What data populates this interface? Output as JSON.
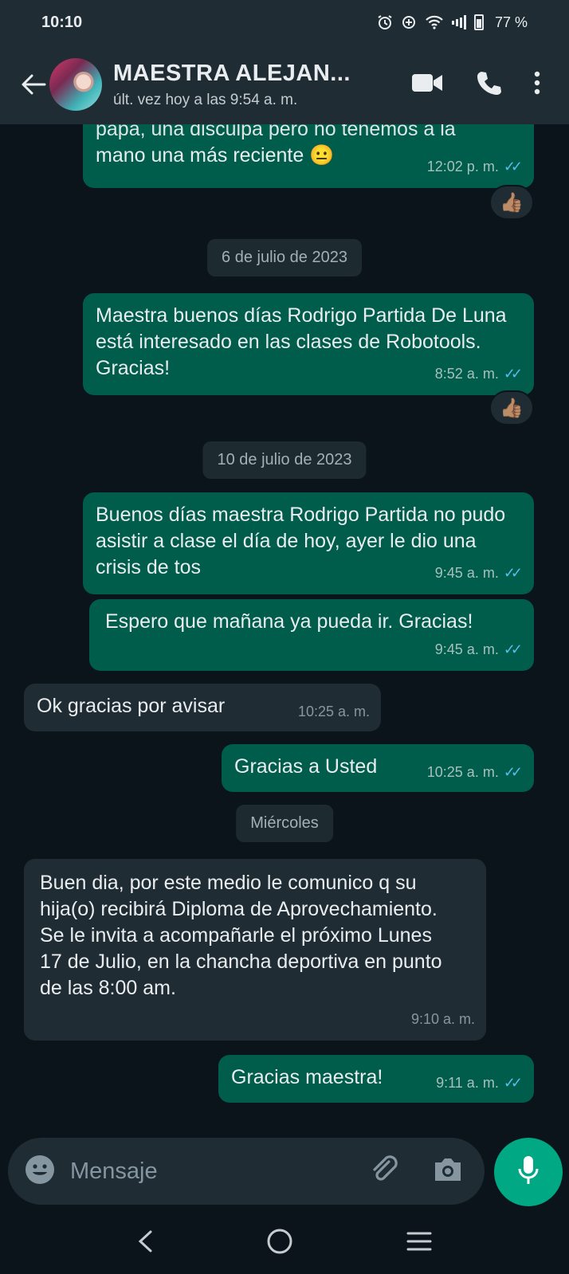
{
  "status_bar": {
    "time": "10:10",
    "battery": "77 %",
    "icons": [
      "alarm-icon",
      "data-saver-icon",
      "wifi-icon",
      "signal-icon",
      "battery-icon"
    ]
  },
  "header": {
    "contact_name": "MAESTRA ALEJAN...",
    "last_seen": "últ. vez hoy a las 9:54 a. m.",
    "actions": [
      "back-arrow-icon",
      "video-call-icon",
      "voice-call-icon",
      "more-options-icon"
    ]
  },
  "messages": [
    {
      "dir": "out",
      "text_line1": "papá, una disculpa pero no tenemos a la",
      "text_line2": "mano una más reciente",
      "emoji": "😐",
      "time": "12:02 p. m.",
      "reaction": "👍🏽"
    },
    {
      "type": "date",
      "text": "6 de julio de 2023"
    },
    {
      "dir": "out",
      "text": "Maestra buenos días Rodrigo Partida De Luna está interesado en las clases de Robotools. Gracias!",
      "time": "8:52 a. m.",
      "reaction": "👍🏽"
    },
    {
      "type": "date",
      "text": "10 de julio de 2023"
    },
    {
      "dir": "out",
      "text": "Buenos días maestra Rodrigo Partida no pudo asistir a clase el día de hoy, ayer le dio una crisis de tos",
      "time": "9:45 a. m."
    },
    {
      "dir": "out",
      "text": "Espero que mañana ya pueda ir. Gracias!",
      "time": "9:45 a. m."
    },
    {
      "dir": "in",
      "text": "Ok gracias por avisar",
      "time": "10:25 a. m."
    },
    {
      "dir": "out",
      "text": "Gracias a Usted",
      "time": "10:25 a. m."
    },
    {
      "type": "date",
      "text": "Miércoles"
    },
    {
      "dir": "in",
      "text": "Buen dia, por este medio le comunico q su hija(o) recibirá Diploma de Aprovechamiento. Se le invita a acompañarle el próximo Lunes 17 de Julio, en la chancha deportiva en punto de las 8:00 am.",
      "time": "9:10 a. m."
    },
    {
      "dir": "out",
      "text": "Gracias maestra!",
      "time": "9:11 a. m."
    }
  ],
  "composer": {
    "placeholder": "Mensaje",
    "icons": [
      "emoji-icon",
      "attach-icon",
      "camera-icon",
      "mic-icon"
    ]
  },
  "colors": {
    "background": "#0b141a",
    "header": "#1f2c34",
    "outgoing_bubble": "#005c4b",
    "incoming_bubble": "#202c33",
    "accent": "#00a884",
    "read_ticks": "#53bdeb"
  }
}
